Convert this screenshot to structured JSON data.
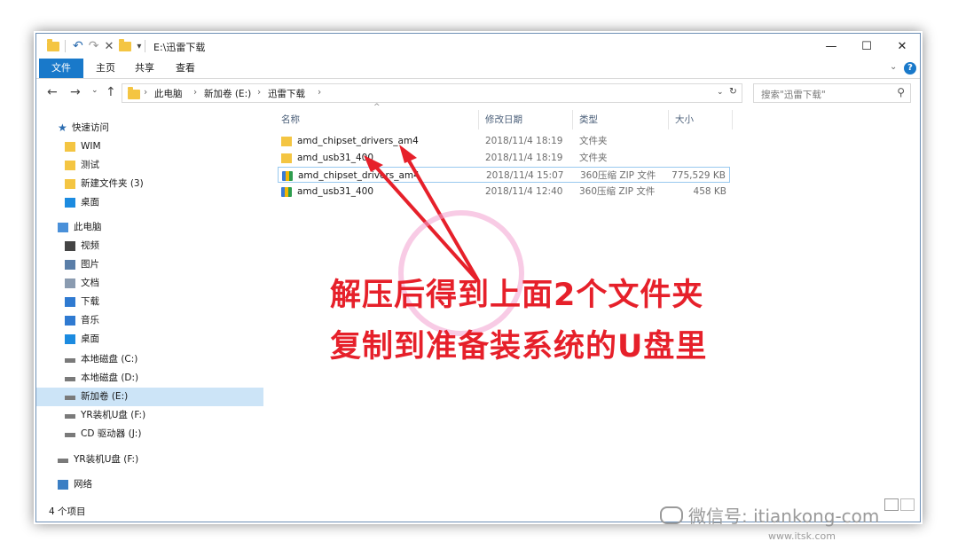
{
  "window": {
    "title": "E:\\迅雷下载",
    "controls": {
      "minimize": "—",
      "maximize": "☐",
      "close": "✕"
    }
  },
  "ribbon": {
    "tabs": [
      "文件",
      "主页",
      "共享",
      "查看"
    ]
  },
  "address": {
    "crumbs": [
      "此电脑",
      "新加卷 (E:)",
      "迅雷下载"
    ],
    "search_placeholder": "搜索\"迅雷下载\""
  },
  "nav": {
    "quick_access": "快速访问",
    "items": [
      {
        "label": "WIM",
        "icon": "folder-icon"
      },
      {
        "label": "测试",
        "icon": "folder-icon"
      },
      {
        "label": "新建文件夹 (3)",
        "icon": "folder-icon"
      },
      {
        "label": "桌面",
        "icon": "desktop-icon"
      },
      {
        "label": "此电脑",
        "icon": "computer-icon"
      },
      {
        "label": "视频",
        "icon": "video-icon"
      },
      {
        "label": "图片",
        "icon": "picture-icon"
      },
      {
        "label": "文档",
        "icon": "document-icon"
      },
      {
        "label": "下载",
        "icon": "download-icon"
      },
      {
        "label": "音乐",
        "icon": "music-icon"
      },
      {
        "label": "桌面",
        "icon": "desktop-icon"
      },
      {
        "label": "本地磁盘 (C:)",
        "icon": "drive-icon"
      },
      {
        "label": "本地磁盘 (D:)",
        "icon": "drive-icon"
      },
      {
        "label": "新加卷 (E:)",
        "icon": "drive-icon",
        "selected": true
      },
      {
        "label": "YR装机U盘 (F:)",
        "icon": "usb-drive-icon"
      },
      {
        "label": "CD 驱动器 (J:)",
        "icon": "cd-drive-icon"
      },
      {
        "label": "YR装机U盘 (F:)",
        "icon": "usb-drive-icon"
      },
      {
        "label": "网络",
        "icon": "network-icon"
      }
    ]
  },
  "columns": {
    "name": "名称",
    "date": "修改日期",
    "type": "类型",
    "size": "大小"
  },
  "files": [
    {
      "name": "amd_chipset_drivers_am4",
      "date": "2018/11/4 18:19",
      "type": "文件夹",
      "size": "",
      "kind": "folder"
    },
    {
      "name": "amd_usb31_400",
      "date": "2018/11/4 18:19",
      "type": "文件夹",
      "size": "",
      "kind": "folder"
    },
    {
      "name": "amd_chipset_drivers_am4",
      "date": "2018/11/4 15:07",
      "type": "360压缩 ZIP 文件",
      "size": "775,529 KB",
      "kind": "zip"
    },
    {
      "name": "amd_usb31_400",
      "date": "2018/11/4 12:40",
      "type": "360压缩 ZIP 文件",
      "size": "458 KB",
      "kind": "zip"
    }
  ],
  "status": {
    "count": "4 个项目"
  },
  "annotation": {
    "line1": "解压后得到上面2个文件夹",
    "line2": "复制到准备装系统的U盘里",
    "color": "#e6202a"
  },
  "watermark": {
    "wechat": "微信号: itiankong-com",
    "site": "www.itsk.com"
  }
}
